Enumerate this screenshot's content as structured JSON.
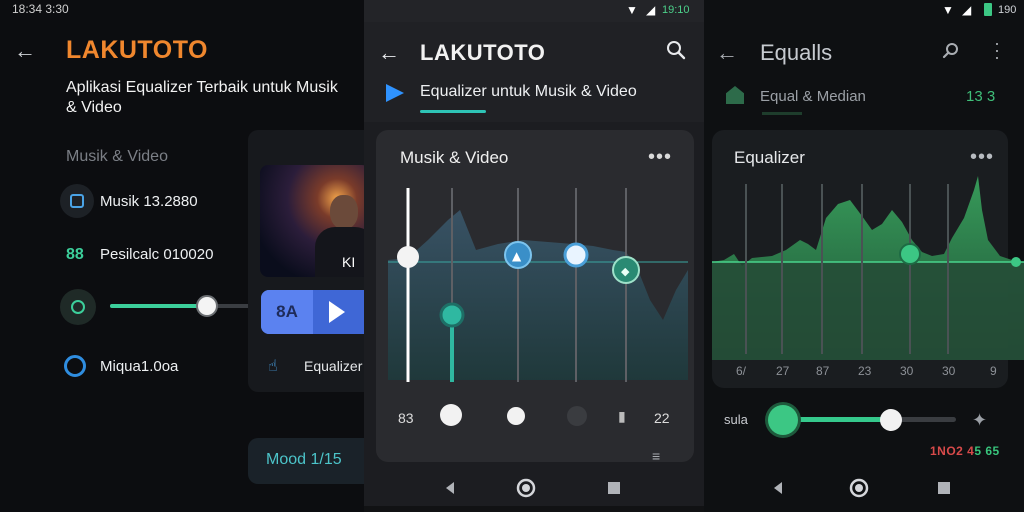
{
  "left": {
    "status_time": "18:34 3:30",
    "brand": "LAKUTOTO",
    "subtitle": "Aplikasi Equalizer Terbaik untuk Musik & Video",
    "section_label": "Musik & Video",
    "rows": [
      {
        "label": "Musik 13.2880",
        "icon": "square-icon"
      },
      {
        "label": "Pesilcalc 010020",
        "icon": "grid-icon"
      },
      {
        "label": "Miqua1.0oa",
        "icon": "ring-icon"
      }
    ],
    "thumb_caption": "KI",
    "player_chip": "8A",
    "player_side_text": "Equalizer",
    "slider_level": 0.68,
    "bottom_pill": "Mood 1/15"
  },
  "middle": {
    "status_text": "19:10",
    "title": "LAKUTOTO",
    "tab_label": "Equalizer untuk Musik & Video",
    "card_title": "Musik & Video",
    "more_icon": "more-icon",
    "left_value": "83",
    "right_value": "22",
    "band_levels": [
      0.9,
      0.3,
      0.58,
      0.58,
      0.52
    ]
  },
  "right": {
    "status_text": "190",
    "title": "Equalls",
    "sub_label": "Equal & Median",
    "sub_value": "13 3",
    "card_title": "Equalizer",
    "band_labels": [
      "6/",
      "27",
      "87",
      "23",
      "30",
      "30",
      "9"
    ],
    "vol_label": "sula",
    "vol_level": 0.63,
    "readout_red": "1NO2 4",
    "readout_green": "5 65"
  },
  "colors": {
    "brand_orange": "#f0872e",
    "accent_teal": "#3ccf9b",
    "accent_blue": "#2f93ff",
    "eq_green": "#3cc784"
  }
}
